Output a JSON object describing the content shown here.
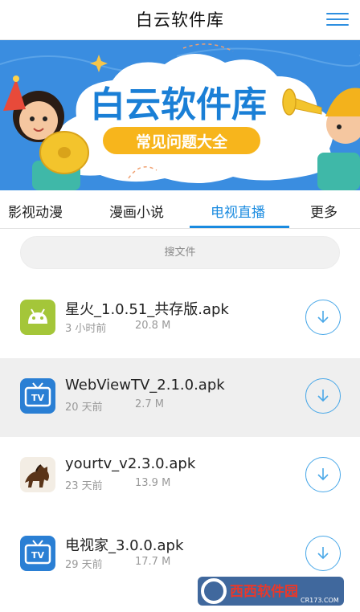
{
  "header": {
    "title": "白云软件库",
    "menu_icon": "hamburger-menu-icon",
    "accent": "#2e8fe0"
  },
  "banner": {
    "title": "白云软件库",
    "subtitle": "常见问题大全",
    "colors": {
      "sky": "#3a8de0",
      "cloud": "#ffffff",
      "title_text": "#1a7fd6",
      "pill": "#f7b51c",
      "pill_text": "#ffffff"
    }
  },
  "tabs": {
    "items": [
      {
        "label": "影视动漫",
        "active": false
      },
      {
        "label": "漫画小说",
        "active": false
      },
      {
        "label": "电视直播",
        "active": true
      },
      {
        "label": "更多",
        "active": false
      }
    ],
    "active_color": "#1a8be0"
  },
  "search": {
    "placeholder": "搜文件"
  },
  "files": [
    {
      "name": "星火_1.0.51_共存版.apk",
      "time": "3 小时前",
      "size": "20.8 M",
      "icon": "android-icon",
      "highlighted": false
    },
    {
      "name": "WebViewTV_2.1.0.apk",
      "time": "20 天前",
      "size": "2.7 M",
      "icon": "tv-app-icon",
      "highlighted": true
    },
    {
      "name": "yourtv_v2.3.0.apk",
      "time": "23 天前",
      "size": "13.9 M",
      "icon": "horse-app-icon",
      "highlighted": false
    },
    {
      "name": "电视家_3.0.0.apk",
      "time": "29 天前",
      "size": "17.7 M",
      "icon": "tv-app-icon",
      "highlighted": false
    }
  ],
  "download_icon": "download-arrow-icon",
  "watermark": {
    "brand": "西西软件园",
    "url": "CR173.COM"
  }
}
